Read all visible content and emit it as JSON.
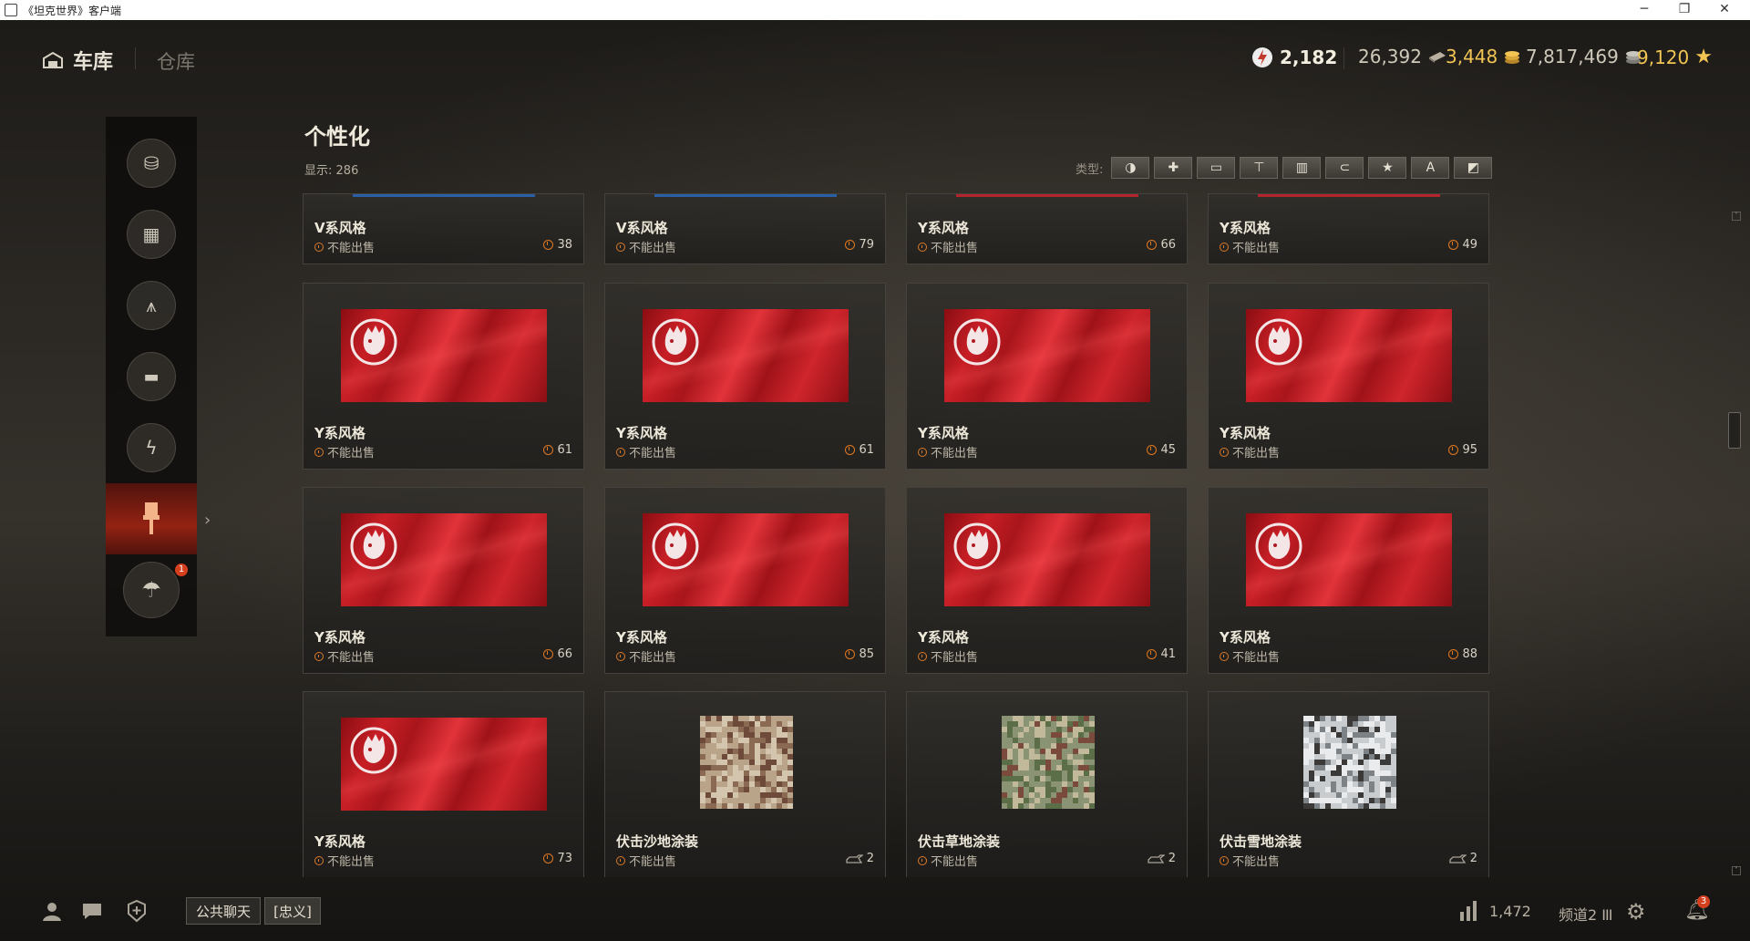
{
  "window": {
    "title": "《坦克世界》客户端"
  },
  "nav": {
    "garage_label": "车库",
    "depot_label": "仓库"
  },
  "currencies": {
    "free_xp": "2,182",
    "bonds_gold_count": "26,392",
    "gold": "3,448",
    "credits": "7,817,469",
    "xp": "9,120"
  },
  "main": {
    "title": "个性化",
    "count_label": "显示:",
    "count_value": "286",
    "filter_label": "类型:",
    "filters": [
      "camouflage-icon",
      "puzzle-icon",
      "license-plate-icon",
      "paint-brush-icon",
      "stripes-icon",
      "modification-icon",
      "star-icon",
      "letter-a-icon",
      "decal-icon"
    ]
  },
  "cards": [
    {
      "name": "V系风格",
      "status": "不能出售",
      "count": "38",
      "count_icon": "clock-icon",
      "kind": "partial",
      "stripe": "#2a5fa8"
    },
    {
      "name": "V系风格",
      "status": "不能出售",
      "count": "79",
      "count_icon": "clock-icon",
      "kind": "partial",
      "stripe": "#2a5fa8"
    },
    {
      "name": "Y系风格",
      "status": "不能出售",
      "count": "66",
      "count_icon": "clock-icon",
      "kind": "partial",
      "stripe": "#b5242a"
    },
    {
      "name": "Y系风格",
      "status": "不能出售",
      "count": "49",
      "count_icon": "clock-icon",
      "kind": "partial",
      "stripe": "#b5242a"
    },
    {
      "name": "Y系风格",
      "status": "不能出售",
      "count": "61",
      "count_icon": "clock-icon",
      "kind": "flag"
    },
    {
      "name": "Y系风格",
      "status": "不能出售",
      "count": "61",
      "count_icon": "clock-icon",
      "kind": "flag"
    },
    {
      "name": "Y系风格",
      "status": "不能出售",
      "count": "45",
      "count_icon": "clock-icon",
      "kind": "flag"
    },
    {
      "name": "Y系风格",
      "status": "不能出售",
      "count": "95",
      "count_icon": "clock-icon",
      "kind": "flag"
    },
    {
      "name": "Y系风格",
      "status": "不能出售",
      "count": "66",
      "count_icon": "clock-icon",
      "kind": "flag"
    },
    {
      "name": "Y系风格",
      "status": "不能出售",
      "count": "85",
      "count_icon": "clock-icon",
      "kind": "flag"
    },
    {
      "name": "Y系风格",
      "status": "不能出售",
      "count": "41",
      "count_icon": "clock-icon",
      "kind": "flag"
    },
    {
      "name": "Y系风格",
      "status": "不能出售",
      "count": "88",
      "count_icon": "clock-icon",
      "kind": "flag"
    },
    {
      "name": "Y系风格",
      "status": "不能出售",
      "count": "73",
      "count_icon": "clock-icon",
      "kind": "flag"
    },
    {
      "name": "伏击沙地涂装",
      "status": "不能出售",
      "count": "2",
      "count_icon": "tank-icon",
      "kind": "camo",
      "palette": [
        "#b9a48a",
        "#8a6a52",
        "#d4c6ae",
        "#6d4a3a"
      ]
    },
    {
      "name": "伏击草地涂装",
      "status": "不能出售",
      "count": "2",
      "count_icon": "tank-icon",
      "kind": "camo",
      "palette": [
        "#8a9474",
        "#5c6e48",
        "#c2b89a",
        "#7a4a3c"
      ]
    },
    {
      "name": "伏击雪地涂装",
      "status": "不能出售",
      "count": "2",
      "count_icon": "tank-icon",
      "kind": "camo",
      "palette": [
        "#c9ccce",
        "#7d8286",
        "#e9ebec",
        "#3c3a38"
      ]
    }
  ],
  "bottom": {
    "public_chat_label": "公共聊天",
    "clan_chat_label": "[忠义]",
    "online_count": "1,472",
    "server_label": "频道2",
    "notification_count": "3"
  },
  "sidebar": {
    "notification_badge": "1"
  }
}
